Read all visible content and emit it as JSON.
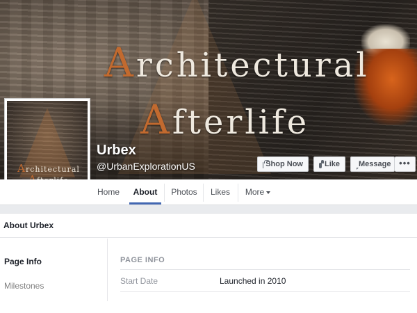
{
  "cover": {
    "title_line1": {
      "cap": "A",
      "rest": "rchitectural"
    },
    "title_line2": {
      "cap": "A",
      "rest": "fterlife"
    }
  },
  "profile": {
    "line1": {
      "cap": "A",
      "rest": "rchitectural"
    },
    "line2": {
      "cap": "A",
      "rest": "fterlife"
    }
  },
  "page": {
    "name": "Urbex",
    "handle": "@UrbanExplorationUS"
  },
  "actions": {
    "shop_now": "Shop Now",
    "like": "Like",
    "message": "Message",
    "more": "•••"
  },
  "nav": {
    "items": [
      {
        "label": "Home"
      },
      {
        "label": "About"
      },
      {
        "label": "Photos"
      },
      {
        "label": "Likes"
      },
      {
        "label": "More"
      }
    ],
    "active": "About"
  },
  "about": {
    "header": "About Urbex",
    "left_menu": [
      "Page Info",
      "Milestones"
    ],
    "section_title": "PAGE INFO",
    "rows": [
      {
        "label": "Start Date",
        "value": "Launched in 2010"
      }
    ]
  },
  "colors": {
    "nav_accent": "#4267b2",
    "rust": "#c26a2f",
    "background": "#e9ebee"
  }
}
